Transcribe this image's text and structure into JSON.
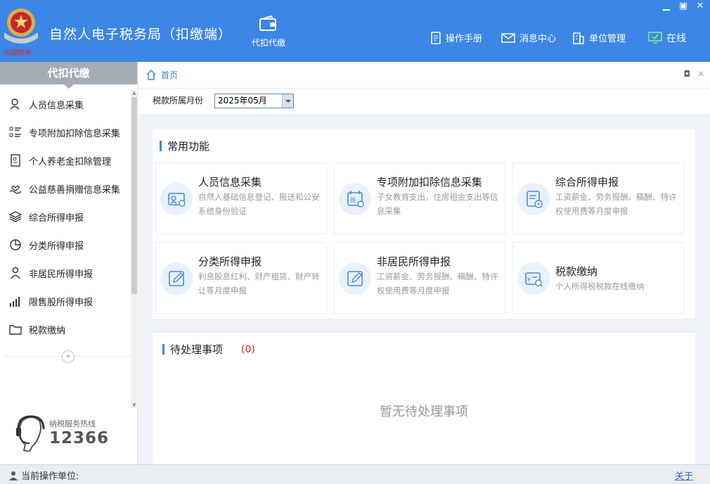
{
  "app": {
    "title": "自然人电子税务局（扣缴端）",
    "logo_text": "中国税务",
    "module_label": "代扣代缴"
  },
  "topnav": {
    "manual": "操作手册",
    "messages": "消息中心",
    "unit_mgmt": "单位管理",
    "online": "在线"
  },
  "sidebar": {
    "header": "代扣代缴",
    "items": [
      {
        "label": "人员信息采集",
        "icon": "person-icon"
      },
      {
        "label": "专项附加扣除信息采集",
        "icon": "list-icon"
      },
      {
        "label": "个人养老金扣除管理",
        "icon": "document-icon"
      },
      {
        "label": "公益慈善捐赠信息采集",
        "icon": "donation-hand-icon"
      },
      {
        "label": "综合所得申报",
        "icon": "layers-icon"
      },
      {
        "label": "分类所得申报",
        "icon": "pie-chart-icon"
      },
      {
        "label": "非居民所得申报",
        "icon": "user-icon"
      },
      {
        "label": "限售股所得申报",
        "icon": "bar-chart-icon"
      },
      {
        "label": "税款缴纳",
        "icon": "folder-icon"
      }
    ],
    "collapse_glyph": "«",
    "hotline_label": "纳税服务热线",
    "hotline_number": "12366"
  },
  "breadcrumb": {
    "home": "首页"
  },
  "filter": {
    "label": "税款所属月份",
    "month": "2025年05月"
  },
  "common": {
    "title": "常用功能",
    "cards": [
      {
        "title": "人员信息采集",
        "desc": "自然人基础信息登记、报送和公安系统身份验证"
      },
      {
        "title": "专项附加扣除信息采集",
        "desc": "子女教育支出，住房租金支出等信息采集"
      },
      {
        "title": "综合所得申报",
        "desc": "工资薪金、劳务报酬、稿酬、特许权使用费等月度申报"
      },
      {
        "title": "分类所得申报",
        "desc": "利息股息红利、财产租赁、财产转让等月度申报"
      },
      {
        "title": "非居民所得申报",
        "desc": "工资薪金、劳务报酬、稿酬、特许权使用费等月度申报"
      },
      {
        "title": "税款缴纳",
        "desc": "个人所得税税款在线缴纳"
      }
    ]
  },
  "pending": {
    "title": "待处理事项",
    "count": "(0)",
    "empty": "暂无待处理事项"
  },
  "status": {
    "current_unit_label": "当前操作单位:",
    "about": "关于"
  },
  "colors": {
    "header_blue": "#3b86e6",
    "accent_red": "#e02020",
    "sidebar_head": "#a6acb4"
  }
}
